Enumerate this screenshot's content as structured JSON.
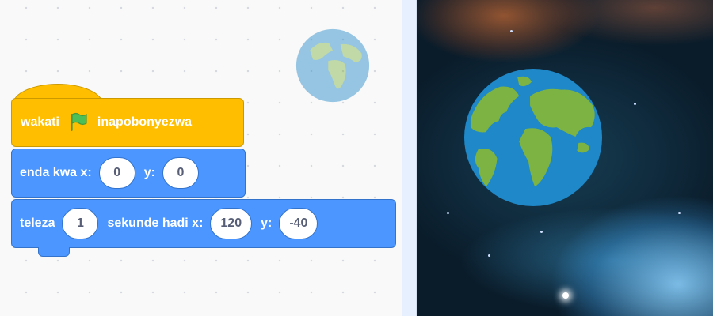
{
  "workspace": {
    "hat_block": {
      "text_before": "wakati",
      "icon": "green-flag-icon",
      "text_after": "inapobonyezwa",
      "color": "#ffbf00"
    },
    "goto_block": {
      "label": "enda kwa x:",
      "x_value": "0",
      "y_label": "y:",
      "y_value": "0",
      "color": "#4c97ff"
    },
    "glide_block": {
      "label": "teleza",
      "seconds_value": "1",
      "middle_label": "sekunde hadi x:",
      "x_value": "120",
      "y_label": "y:",
      "y_value": "-40",
      "color": "#4c97ff"
    },
    "sprite_thumbnail_icon": "earth-icon"
  },
  "stage": {
    "sprite_icon": "earth-icon",
    "backdrop": "space"
  }
}
